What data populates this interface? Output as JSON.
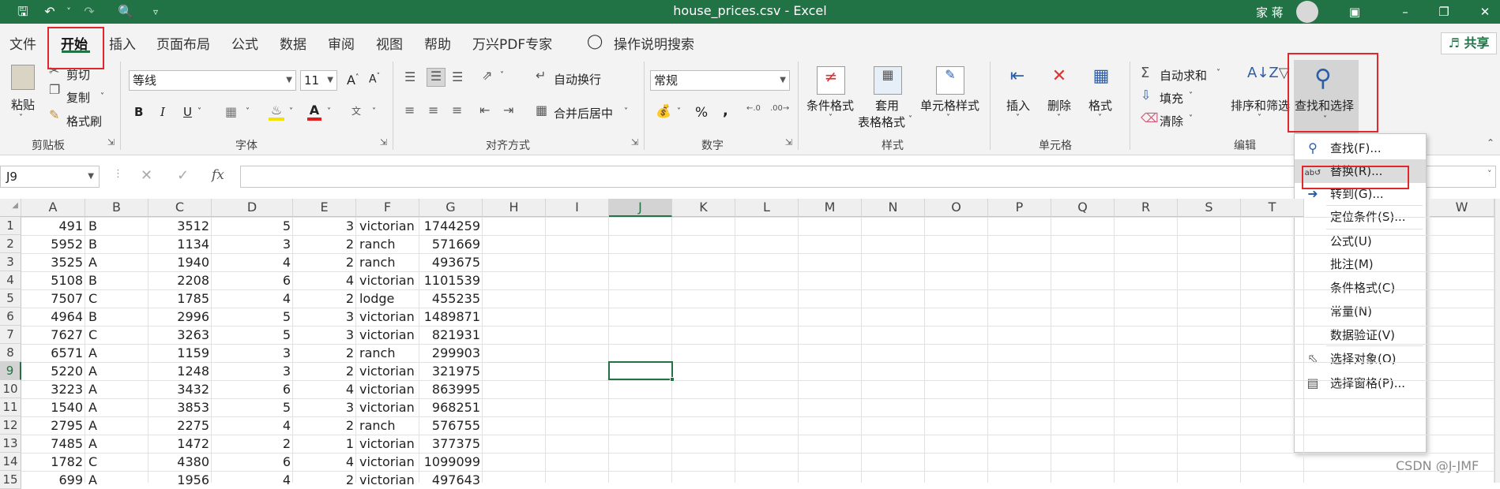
{
  "window": {
    "title": "house_prices.csv  -  Excel",
    "user": "家 蒋"
  },
  "tabs": [
    "文件",
    "开始",
    "插入",
    "页面布局",
    "公式",
    "数据",
    "审阅",
    "视图",
    "帮助",
    "万兴PDF专家",
    "操作说明搜索"
  ],
  "share_label": "共享",
  "ribbon": {
    "clipboard": {
      "paste": "粘贴",
      "cut": "剪切",
      "copy": "复制",
      "format_painter": "格式刷",
      "label": "剪贴板"
    },
    "font": {
      "name": "等线",
      "size": "11",
      "label": "字体",
      "bold": "B",
      "italic": "I",
      "underline": "U"
    },
    "alignment": {
      "wrap": "自动换行",
      "merge": "合并后居中",
      "label": "对齐方式"
    },
    "number": {
      "format": "常规",
      "percent": "%",
      "comma": ",",
      "label": "数字"
    },
    "styles": {
      "conditional": "条件格式",
      "table1": "套用",
      "table2": "表格格式",
      "cell_styles": "单元格样式",
      "label": "样式"
    },
    "cells": {
      "insert": "插入",
      "delete": "删除",
      "format": "格式",
      "label": "单元格"
    },
    "editing": {
      "autosum": "自动求和",
      "fill": "填充",
      "clear": "清除",
      "sort": "排序和筛选",
      "find": "查找和选择",
      "label": "编辑"
    }
  },
  "name_box": "J9",
  "fx": "fx",
  "columns": [
    "A",
    "B",
    "C",
    "D",
    "E",
    "F",
    "G",
    "H",
    "I",
    "J",
    "K",
    "L",
    "M",
    "N",
    "O",
    "P",
    "Q",
    "R",
    "S",
    "T",
    "W"
  ],
  "rows": [
    [
      "1",
      "491",
      "B",
      "3512",
      "5",
      "3",
      "victorian",
      "1744259"
    ],
    [
      "2",
      "5952",
      "B",
      "1134",
      "3",
      "2",
      "ranch",
      "571669"
    ],
    [
      "3",
      "3525",
      "A",
      "1940",
      "4",
      "2",
      "ranch",
      "493675"
    ],
    [
      "4",
      "5108",
      "B",
      "2208",
      "6",
      "4",
      "victorian",
      "1101539"
    ],
    [
      "5",
      "7507",
      "C",
      "1785",
      "4",
      "2",
      "lodge",
      "455235"
    ],
    [
      "6",
      "4964",
      "B",
      "2996",
      "5",
      "3",
      "victorian",
      "1489871"
    ],
    [
      "7",
      "7627",
      "C",
      "3263",
      "5",
      "3",
      "victorian",
      "821931"
    ],
    [
      "8",
      "6571",
      "A",
      "1159",
      "3",
      "2",
      "ranch",
      "299903"
    ],
    [
      "9",
      "5220",
      "A",
      "1248",
      "3",
      "2",
      "victorian",
      "321975"
    ],
    [
      "10",
      "3223",
      "A",
      "3432",
      "6",
      "4",
      "victorian",
      "863995"
    ],
    [
      "11",
      "1540",
      "A",
      "3853",
      "5",
      "3",
      "victorian",
      "968251"
    ],
    [
      "12",
      "2795",
      "A",
      "2275",
      "4",
      "2",
      "ranch",
      "576755"
    ],
    [
      "13",
      "7485",
      "A",
      "1472",
      "2",
      "1",
      "victorian",
      "377375"
    ],
    [
      "14",
      "1782",
      "C",
      "4380",
      "6",
      "4",
      "victorian",
      "1099099"
    ],
    [
      "15",
      "699",
      "A",
      "1956",
      "4",
      "2",
      "victorian",
      "497643"
    ]
  ],
  "dropdown": [
    {
      "label": "查找(F)...",
      "icon": "search-icon"
    },
    {
      "label": "替换(R)...",
      "icon": "replace-icon"
    },
    {
      "label": "转到(G)...",
      "icon": "arrow-right-icon"
    },
    {
      "label": "定位条件(S)...",
      "icon": ""
    },
    {
      "label": "公式(U)",
      "icon": ""
    },
    {
      "label": "批注(M)",
      "icon": ""
    },
    {
      "label": "条件格式(C)",
      "icon": ""
    },
    {
      "label": "常量(N)",
      "icon": ""
    },
    {
      "label": "数据验证(V)",
      "icon": ""
    },
    {
      "label": "选择对象(O)",
      "icon": "cursor-icon"
    },
    {
      "label": "选择窗格(P)...",
      "icon": "selection-pane-icon"
    }
  ],
  "watermark": "CSDN @J-JMF",
  "colors": {
    "excel_green": "#217346",
    "highlight_red": "#e0282c"
  }
}
